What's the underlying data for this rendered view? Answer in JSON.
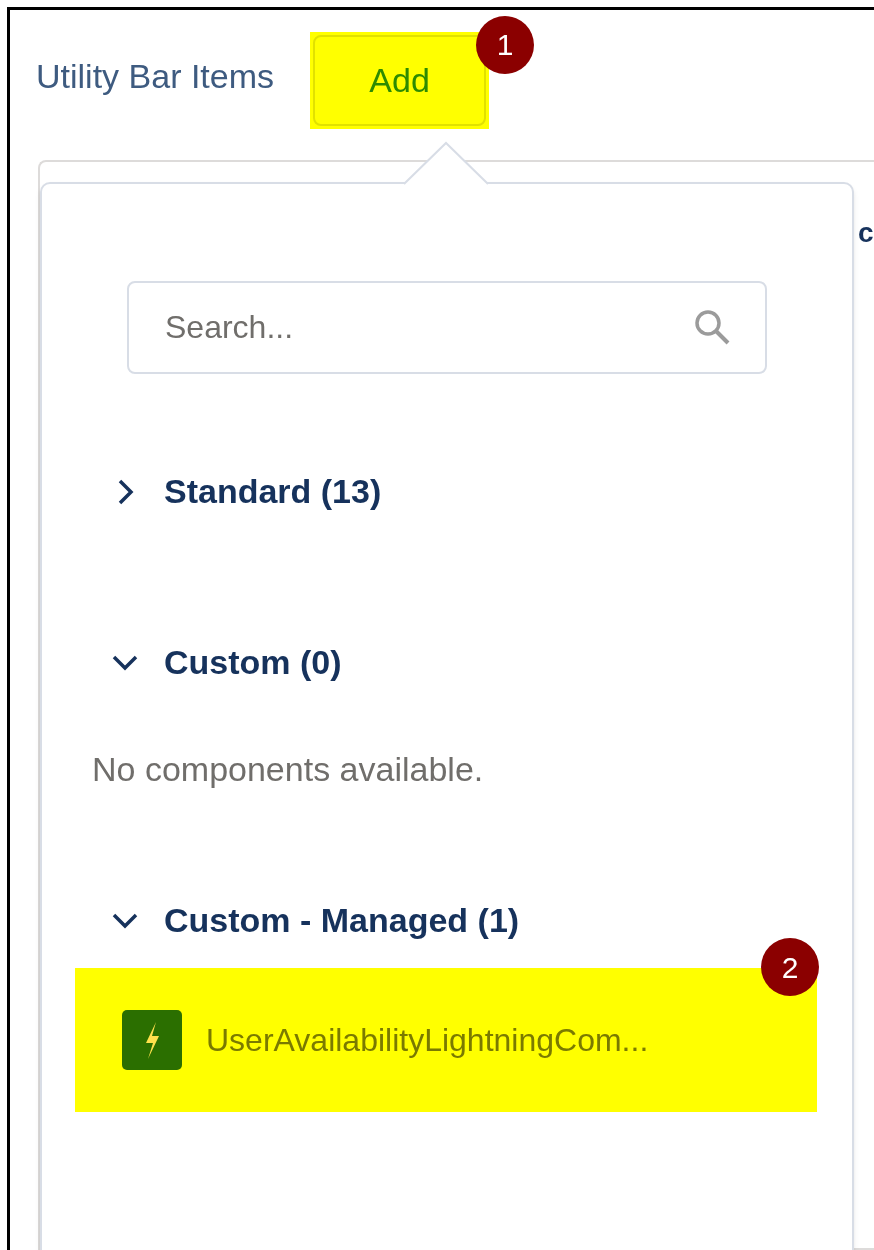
{
  "header": {
    "title": "Utility Bar Items",
    "add_button": {
      "label": "Add",
      "highlighted": true,
      "callout": "1"
    }
  },
  "background_panel": {
    "text": "c"
  },
  "popover": {
    "search": {
      "placeholder": "Search..."
    },
    "sections": [
      {
        "title": "Standard (13)",
        "expanded": false
      },
      {
        "title": "Custom (0)",
        "expanded": true,
        "empty_message": "No components available."
      },
      {
        "title": "Custom - Managed (1)",
        "expanded": true,
        "items": [
          {
            "label": "UserAvailabilityLightningCom...",
            "highlighted": true,
            "callout": "2"
          }
        ]
      }
    ]
  }
}
